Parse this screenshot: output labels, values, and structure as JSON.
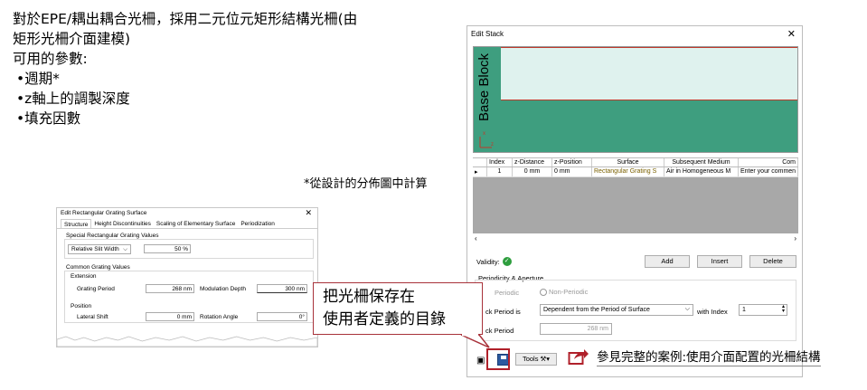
{
  "slide": {
    "line1": "對於EPE/耦出耦合光柵，採用二元位元矩形結構光柵(由",
    "line2": "矩形光柵介面建模)",
    "params_heading": "可用的參數:",
    "bullets": [
      "•週期*",
      "•z軸上的調製深度",
      "•填充因數"
    ],
    "footnote": "*從設計的分佈圖中計算"
  },
  "small_dialog": {
    "title": "Edit Rectangular Grating Surface",
    "close": "✕",
    "tabs": [
      "Structure",
      "Height Discontinuities",
      "Scaling of Elementary Surface",
      "Periodization"
    ],
    "special_group": "Special Rectangular Grating Values",
    "slit_select": "Relative Slit Width",
    "slit_value": "50 %",
    "common_group": "Common Grating Values",
    "extension_label": "Extension",
    "grating_period_label": "Grating Period",
    "grating_period_value": "268 nm",
    "modulation_depth_label": "Modulation Depth",
    "modulation_depth_value": "300 nm",
    "position_label": "Position",
    "lateral_shift_label": "Lateral Shift",
    "lateral_shift_value": "0 mm",
    "rotation_angle_label": "Rotation Angle",
    "rotation_angle_value": "0°"
  },
  "stack_dialog": {
    "title": "Edit Stack",
    "close": "✕",
    "block_label": "Base Block",
    "axis_x": "x",
    "axis_z": "z",
    "columns": [
      "Index",
      "z-Distance",
      "z-Position",
      "Surface",
      "Subsequent Medium",
      "Com"
    ],
    "row": {
      "marker": "▸",
      "index": "1",
      "z_distance": "0 mm",
      "z_position": "0 mm",
      "surface": "Rectangular Grating S",
      "medium": "Air in Homogeneous M",
      "comment": "Enter your commen"
    },
    "scroll_left": "‹",
    "scroll_right": "›",
    "validity_label": "Validity:",
    "validity_icon": "✓",
    "add_label": "Add",
    "insert_label": "Insert",
    "delete_label": "Delete",
    "periodicity_group": "Periodicity & Aperture",
    "periodic_label": "Periodic",
    "non_periodic_label": "Non-Periodic",
    "stack_period_is_label": "ck Period is",
    "stack_period_mode": "Dependent from the Period of Surface",
    "with_index_label": "with Index",
    "with_index_value": "1",
    "stack_period_label": "ck Period",
    "stack_period_value": "268 nm",
    "tools_label": "Tools"
  },
  "callout": {
    "line1": "把光柵保存在",
    "line2": "使用者定義的目錄"
  },
  "link": {
    "text": "參見完整的案例:使用介面配置的光柵結構"
  },
  "colors": {
    "stack_green": "#3e9e7f",
    "stack_light": "#dff2ee",
    "callout_border": "#a8323a",
    "highlight_red": "#b0202a"
  }
}
